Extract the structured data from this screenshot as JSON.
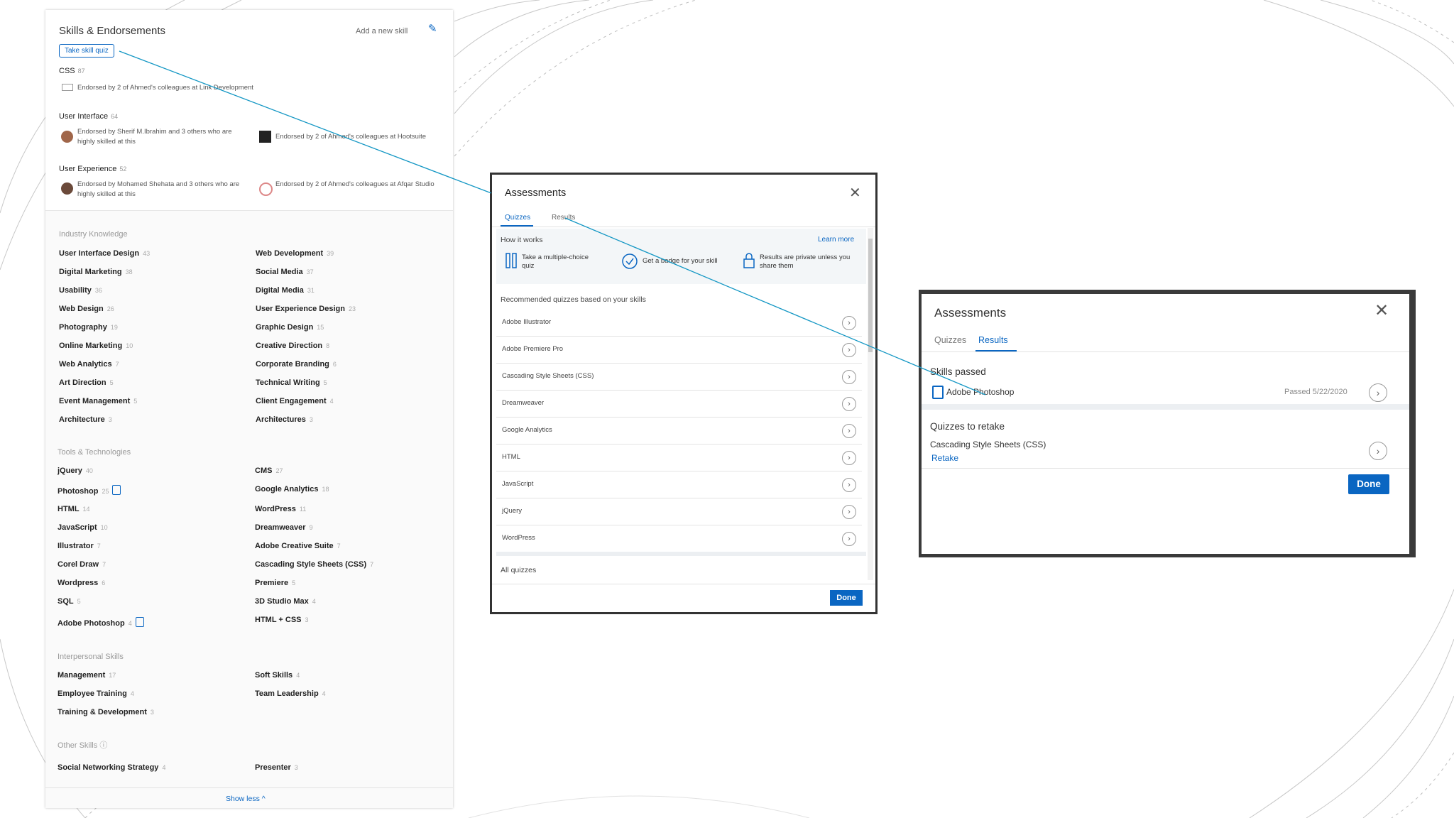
{
  "profile": {
    "title": "Skills & Endorsements",
    "add_skill": "Add a new skill",
    "quiz_button": "Take skill quiz",
    "top_skills": [
      {
        "name": "CSS",
        "count": "87",
        "endorsements": [
          "Endorsed by 2 of Ahmed's colleagues at Link Development"
        ]
      },
      {
        "name": "User Interface",
        "count": "64",
        "endorsements": [
          "Endorsed by Sherif M.Ibrahim and 3 others who are highly skilled at this",
          "Endorsed by 2 of Ahmed's colleagues at Hootsuite"
        ]
      },
      {
        "name": "User Experience",
        "count": "52",
        "endorsements": [
          "Endorsed by Mohamed Shehata and 3 others who are highly skilled at this",
          "Endorsed by 2 of Ahmed's colleagues at Afqar Studio"
        ]
      }
    ],
    "categories": [
      {
        "label": "Industry Knowledge",
        "left": [
          {
            "name": "User Interface Design",
            "count": "43"
          },
          {
            "name": "Digital Marketing",
            "count": "38"
          },
          {
            "name": "Usability",
            "count": "36"
          },
          {
            "name": "Web Design",
            "count": "26"
          },
          {
            "name": "Photography",
            "count": "19"
          },
          {
            "name": "Online Marketing",
            "count": "10"
          },
          {
            "name": "Web Analytics",
            "count": "7"
          },
          {
            "name": "Art Direction",
            "count": "5"
          },
          {
            "name": "Event Management",
            "count": "5"
          },
          {
            "name": "Architecture",
            "count": "3"
          }
        ],
        "right": [
          {
            "name": "Web Development",
            "count": "39"
          },
          {
            "name": "Social Media",
            "count": "37"
          },
          {
            "name": "Digital Media",
            "count": "31"
          },
          {
            "name": "User Experience Design",
            "count": "23"
          },
          {
            "name": "Graphic Design",
            "count": "15"
          },
          {
            "name": "Creative Direction",
            "count": "8"
          },
          {
            "name": "Corporate Branding",
            "count": "6"
          },
          {
            "name": "Technical Writing",
            "count": "5"
          },
          {
            "name": "Client Engagement",
            "count": "4"
          },
          {
            "name": "Architectures",
            "count": "3"
          }
        ]
      },
      {
        "label": "Tools & Technologies",
        "left": [
          {
            "name": "jQuery",
            "count": "40"
          },
          {
            "name": "Photoshop",
            "count": "25"
          },
          {
            "name": "HTML",
            "count": "14"
          },
          {
            "name": "JavaScript",
            "count": "10"
          },
          {
            "name": "Illustrator",
            "count": "7"
          },
          {
            "name": "Corel Draw",
            "count": "7"
          },
          {
            "name": "Wordpress",
            "count": "6"
          },
          {
            "name": "SQL",
            "count": "5"
          },
          {
            "name": "Adobe Photoshop",
            "count": "4"
          }
        ],
        "right": [
          {
            "name": "CMS",
            "count": "27"
          },
          {
            "name": "Google Analytics",
            "count": "18"
          },
          {
            "name": "WordPress",
            "count": "11"
          },
          {
            "name": "Dreamweaver",
            "count": "9"
          },
          {
            "name": "Adobe Creative Suite",
            "count": "7"
          },
          {
            "name": "Cascading Style Sheets (CSS)",
            "count": "7"
          },
          {
            "name": "Premiere",
            "count": "5"
          },
          {
            "name": "3D Studio Max",
            "count": "4"
          },
          {
            "name": "HTML + CSS",
            "count": "3"
          }
        ]
      },
      {
        "label": "Interpersonal Skills",
        "left": [
          {
            "name": "Management",
            "count": "17"
          },
          {
            "name": "Employee Training",
            "count": "4"
          },
          {
            "name": "Training & Development",
            "count": "3"
          }
        ],
        "right": [
          {
            "name": "Soft Skills",
            "count": "4"
          },
          {
            "name": "Team Leadership",
            "count": "4"
          }
        ]
      },
      {
        "label": "Other Skills",
        "left": [
          {
            "name": "Social Networking Strategy",
            "count": "4"
          }
        ],
        "right": [
          {
            "name": "Presenter",
            "count": "3"
          }
        ]
      }
    ],
    "show_less": "Show less ^"
  },
  "assessments_quizzes": {
    "title": "Assessments",
    "tabs": [
      "Quizzes",
      "Results"
    ],
    "how_it_works": "How it works",
    "learn_more": "Learn more",
    "steps": [
      "Take a multiple-choice quiz",
      "Get a badge for your skill",
      "Results are private unless you share them"
    ],
    "recommended_label": "Recommended quizzes based on your skills",
    "quizzes": [
      "Adobe Illustrator",
      "Adobe Premiere Pro",
      "Cascading Style Sheets (CSS)",
      "Dreamweaver",
      "Google Analytics",
      "HTML",
      "JavaScript",
      "jQuery",
      "WordPress"
    ],
    "all_quizzes": "All quizzes",
    "done": "Done"
  },
  "assessments_results": {
    "title": "Assessments",
    "tabs": [
      "Quizzes",
      "Results"
    ],
    "skills_passed_label": "Skills passed",
    "passed_skill": "Adobe Photoshop",
    "passed_date": "Passed 5/22/2020",
    "retake_label": "Quizzes to retake",
    "retake_skill": "Cascading Style Sheets (CSS)",
    "retake_link": "Retake",
    "done": "Done"
  },
  "colors": {
    "accent": "#0a66c2",
    "modal_border": "#333333"
  }
}
